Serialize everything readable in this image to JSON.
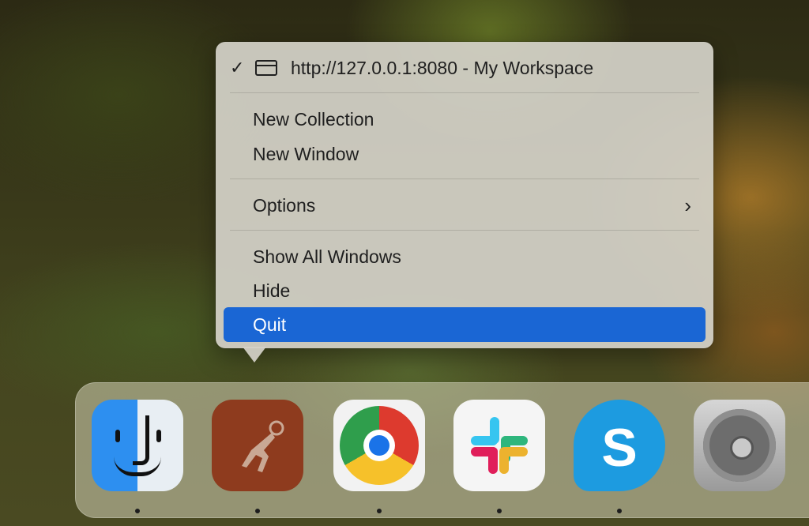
{
  "menu": {
    "current_window": "http://127.0.0.1:8080 - My Workspace",
    "new_collection": "New Collection",
    "new_window": "New Window",
    "options": "Options",
    "options_chevron": "›",
    "show_all_windows": "Show All Windows",
    "hide": "Hide",
    "quit": "Quit",
    "checkmark": "✓",
    "selected_item": "Quit",
    "highlight_color": "#1a66d4"
  },
  "dock": {
    "apps": [
      {
        "name": "Finder",
        "icon": "finder-icon",
        "running": true
      },
      {
        "name": "Postman",
        "icon": "postman-icon",
        "running": true
      },
      {
        "name": "Google Chrome",
        "icon": "chrome-icon",
        "running": true
      },
      {
        "name": "Slack",
        "icon": "slack-icon",
        "running": true
      },
      {
        "name": "Skype",
        "icon": "skype-icon",
        "running": true,
        "glyph": "S"
      },
      {
        "name": "System Settings",
        "icon": "settings-gear-icon",
        "running": false
      }
    ]
  }
}
